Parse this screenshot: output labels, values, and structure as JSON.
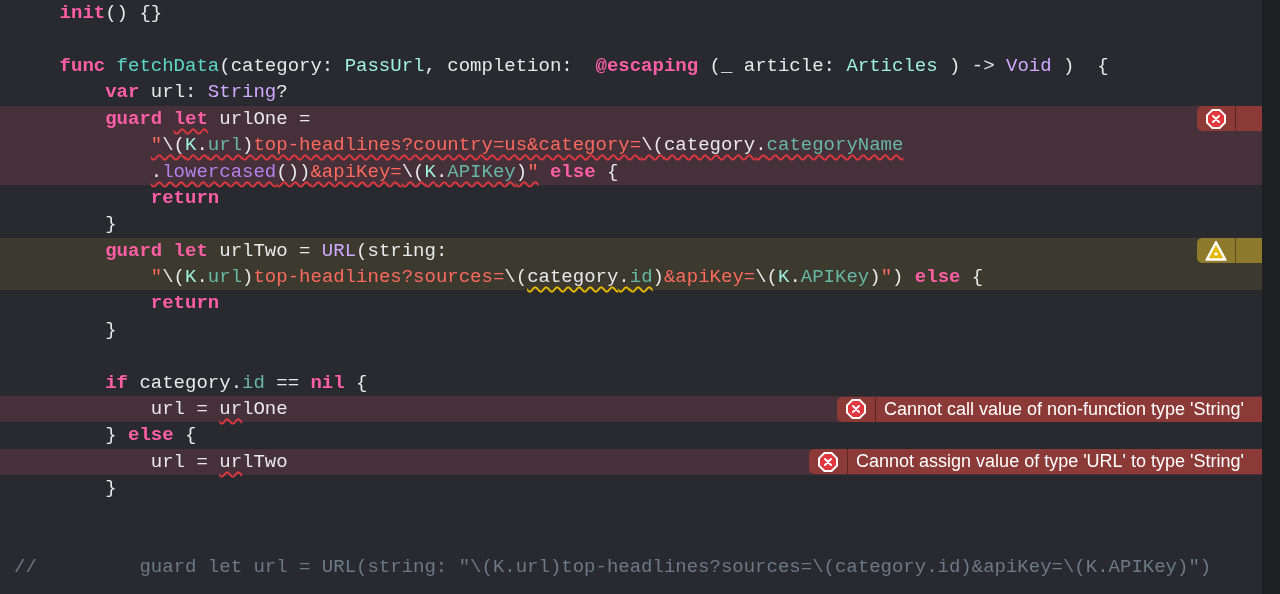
{
  "editor": {
    "lines": [
      {
        "kind": "code",
        "tokens": [
          {
            "t": "init",
            "kind": "kw"
          },
          {
            "t": "() {}",
            "kind": "plain"
          }
        ]
      },
      {
        "kind": "blank"
      },
      {
        "kind": "code",
        "tokens": [
          {
            "t": "func ",
            "kind": "kw"
          },
          {
            "t": "fetchData",
            "kind": "decl"
          },
          {
            "t": "(category: ",
            "kind": "plain"
          },
          {
            "t": "PassUrl",
            "kind": "ptype"
          },
          {
            "t": ", completion:  ",
            "kind": "plain"
          },
          {
            "t": "@escaping",
            "kind": "kw"
          },
          {
            "t": " (_ article: ",
            "kind": "plain"
          },
          {
            "t": "Articles",
            "kind": "ptype"
          },
          {
            "t": " ) -> ",
            "kind": "plain"
          },
          {
            "t": "Void",
            "kind": "stype"
          },
          {
            "t": " )  {",
            "kind": "plain"
          }
        ],
        "children": [
          {
            "kind": "code",
            "tokens": [
              {
                "t": "var",
                "kind": "kw"
              },
              {
                "t": " url: ",
                "kind": "plain"
              },
              {
                "t": "String",
                "kind": "stype"
              },
              {
                "t": "?",
                "kind": "plain"
              }
            ]
          },
          {
            "kind": "code",
            "error": true,
            "annotation": {
              "kind": "error"
            },
            "tokens": [
              {
                "t": "guard ",
                "kind": "kw"
              },
              {
                "t": "let",
                "kind": "kw",
                "error_squiggle": true
              },
              {
                "t": " urlOne =",
                "kind": "plain"
              }
            ],
            "children": [
              {
                "kind": "code",
                "error": true,
                "tokens": [
                  {
                    "t": "\"",
                    "kind": "str",
                    "error_squiggle": true
                  },
                  {
                    "t": "\\(",
                    "kind": "plain",
                    "error_squiggle": true
                  },
                  {
                    "t": "K",
                    "kind": "ptype",
                    "error_squiggle": true
                  },
                  {
                    "t": ".",
                    "kind": "plain",
                    "error_squiggle": true
                  },
                  {
                    "t": "url",
                    "kind": "prop",
                    "error_squiggle": true
                  },
                  {
                    "t": ")",
                    "kind": "plain",
                    "error_squiggle": true
                  },
                  {
                    "t": "top-headlines?country=us&category=",
                    "kind": "str",
                    "error_squiggle": true
                  },
                  {
                    "t": "\\(",
                    "kind": "plain",
                    "error_squiggle": true
                  },
                  {
                    "t": "category",
                    "kind": "plain",
                    "error_squiggle": true
                  },
                  {
                    "t": ".",
                    "kind": "plain",
                    "error_squiggle": true
                  },
                  {
                    "t": "categoryName",
                    "kind": "prop",
                    "error_squiggle": true
                  }
                ]
              },
              {
                "kind": "code",
                "error": true,
                "tokens": [
                  {
                    "t": ".",
                    "kind": "plain",
                    "error_squiggle": true
                  },
                  {
                    "t": "lowercased",
                    "kind": "method",
                    "error_squiggle": true
                  },
                  {
                    "t": "())",
                    "kind": "plain",
                    "error_squiggle": true
                  },
                  {
                    "t": "&apiKey=",
                    "kind": "str",
                    "error_squiggle": true
                  },
                  {
                    "t": "\\(",
                    "kind": "plain",
                    "error_squiggle": true
                  },
                  {
                    "t": "K",
                    "kind": "ptype",
                    "error_squiggle": true
                  },
                  {
                    "t": ".",
                    "kind": "plain",
                    "error_squiggle": true
                  },
                  {
                    "t": "APIKey",
                    "kind": "prop",
                    "error_squiggle": true
                  },
                  {
                    "t": ")",
                    "kind": "plain",
                    "error_squiggle": true
                  },
                  {
                    "t": "\"",
                    "kind": "str",
                    "error_squiggle": true
                  },
                  {
                    "t": " else",
                    "kind": "kw"
                  },
                  {
                    "t": " {",
                    "kind": "plain"
                  }
                ]
              },
              {
                "kind": "code",
                "tokens": [
                  {
                    "t": "return",
                    "kind": "kw"
                  }
                ]
              }
            ]
          },
          {
            "kind": "code",
            "tokens": [
              {
                "t": "}",
                "kind": "plain"
              }
            ]
          },
          {
            "kind": "code",
            "warning": true,
            "annotation": {
              "kind": "warning"
            },
            "tokens": [
              {
                "t": "guard let",
                "kind": "kw"
              },
              {
                "t": " urlTwo = ",
                "kind": "plain"
              },
              {
                "t": "URL",
                "kind": "stype"
              },
              {
                "t": "(string:",
                "kind": "plain"
              }
            ],
            "children": [
              {
                "kind": "code",
                "warning": true,
                "tokens": [
                  {
                    "t": "\"",
                    "kind": "str"
                  },
                  {
                    "t": "\\(",
                    "kind": "plain"
                  },
                  {
                    "t": "K",
                    "kind": "ptype"
                  },
                  {
                    "t": ".",
                    "kind": "plain"
                  },
                  {
                    "t": "url",
                    "kind": "prop"
                  },
                  {
                    "t": ")",
                    "kind": "plain"
                  },
                  {
                    "t": "top-headlines?sources=",
                    "kind": "str"
                  },
                  {
                    "t": "\\(",
                    "kind": "plain"
                  },
                  {
                    "t": "category",
                    "kind": "plain",
                    "warning_squiggle": true
                  },
                  {
                    "t": ".",
                    "kind": "plain",
                    "warning_squiggle": true
                  },
                  {
                    "t": "id",
                    "kind": "prop",
                    "warning_squiggle": true
                  },
                  {
                    "t": ")",
                    "kind": "plain"
                  },
                  {
                    "t": "&apiKey=",
                    "kind": "str"
                  },
                  {
                    "t": "\\(",
                    "kind": "plain"
                  },
                  {
                    "t": "K",
                    "kind": "ptype"
                  },
                  {
                    "t": ".",
                    "kind": "plain"
                  },
                  {
                    "t": "APIKey",
                    "kind": "prop"
                  },
                  {
                    "t": ")",
                    "kind": "plain"
                  },
                  {
                    "t": "\"",
                    "kind": "str"
                  },
                  {
                    "t": ") ",
                    "kind": "plain"
                  },
                  {
                    "t": "else",
                    "kind": "kw"
                  },
                  {
                    "t": " {",
                    "kind": "plain"
                  }
                ]
              },
              {
                "kind": "code",
                "tokens": [
                  {
                    "t": "return",
                    "kind": "kw"
                  }
                ]
              }
            ]
          },
          {
            "kind": "code",
            "tokens": [
              {
                "t": "}",
                "kind": "plain"
              }
            ]
          },
          {
            "kind": "blank"
          },
          {
            "kind": "code",
            "tokens": [
              {
                "t": "if",
                "kind": "kw"
              },
              {
                "t": " category.",
                "kind": "plain"
              },
              {
                "t": "id",
                "kind": "prop"
              },
              {
                "t": " == ",
                "kind": "plain"
              },
              {
                "t": "nil",
                "kind": "kw"
              },
              {
                "t": " {",
                "kind": "plain"
              }
            ],
            "children": [
              {
                "kind": "code",
                "error": true,
                "annotation": {
                  "kind": "error",
                  "message": "Cannot call value of non-function type 'String'"
                },
                "tokens": [
                  {
                    "t": "url = ",
                    "kind": "plain"
                  },
                  {
                    "t": "ur",
                    "kind": "plain",
                    "error_squiggle": true
                  },
                  {
                    "t": "lOne",
                    "kind": "plain"
                  }
                ]
              }
            ]
          },
          {
            "kind": "code",
            "tokens": [
              {
                "t": "} ",
                "kind": "plain"
              },
              {
                "t": "else",
                "kind": "kw"
              },
              {
                "t": " {",
                "kind": "plain"
              }
            ],
            "children": [
              {
                "kind": "code",
                "error": true,
                "annotation": {
                  "kind": "error",
                  "message": "Cannot assign value of type 'URL' to type 'String'"
                },
                "tokens": [
                  {
                    "t": "url = ",
                    "kind": "plain"
                  },
                  {
                    "t": "ur",
                    "kind": "plain",
                    "error_squiggle": true
                  },
                  {
                    "t": "lTwo",
                    "kind": "plain"
                  }
                ]
              }
            ]
          },
          {
            "kind": "code",
            "tokens": [
              {
                "t": "}",
                "kind": "plain"
              }
            ]
          }
        ]
      },
      {
        "kind": "blank"
      },
      {
        "kind": "blank"
      },
      {
        "kind": "comment",
        "tokens": [
          {
            "t": "//         guard let url = URL(string: \"\\(K.url)top-headlines?sources=\\(category.id)&apiKey=\\(K.APIKey)\")",
            "kind": "comment"
          }
        ]
      }
    ]
  }
}
